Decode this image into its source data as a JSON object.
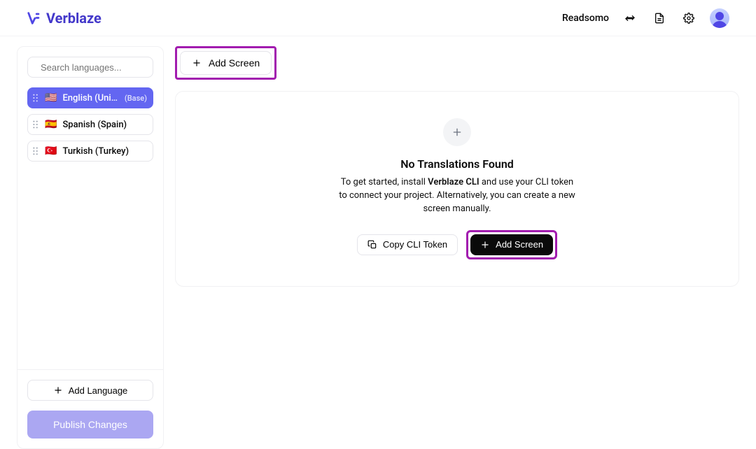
{
  "header": {
    "logo_text": "Verblaze",
    "project_name": "Readsomo"
  },
  "sidebar": {
    "search_placeholder": "Search languages...",
    "languages": [
      {
        "flag": "🇺🇸",
        "name": "English (Unite...",
        "tag": "(Base)",
        "active": true
      },
      {
        "flag": "🇪🇸",
        "name": "Spanish (Spain)",
        "tag": "",
        "active": false
      },
      {
        "flag": "🇹🇷",
        "name": "Turkish (Turkey)",
        "tag": "",
        "active": false
      }
    ],
    "add_language_label": "Add Language",
    "publish_label": "Publish Changes"
  },
  "toolbar": {
    "add_screen_label": "Add Screen"
  },
  "empty_state": {
    "title": "No Translations Found",
    "desc_prefix": "To get started, install ",
    "desc_strong": "Verblaze CLI",
    "desc_suffix": " and use your CLI token to connect your project. Alternatively, you can create a new screen manually.",
    "copy_cli_label": "Copy CLI Token",
    "add_screen_label": "Add Screen"
  },
  "colors": {
    "accent": "#6366f1",
    "highlight": "#a21caf"
  }
}
